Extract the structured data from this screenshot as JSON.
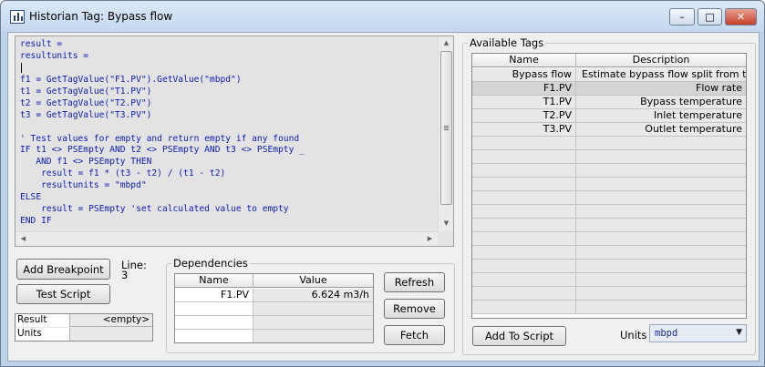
{
  "window": {
    "title": "Historian Tag: Bypass flow",
    "buttons": {
      "minimize": "–",
      "maximize": "□",
      "close": "✕"
    }
  },
  "editor": {
    "lines": [
      "result =",
      "resultunits =",
      "",
      "f1 = GetTagValue(\"F1.PV\").GetValue(\"mbpd\")",
      "t1 = GetTagValue(\"T1.PV\")",
      "t2 = GetTagValue(\"T2.PV\")",
      "t3 = GetTagValue(\"T3.PV\")",
      "",
      "' Test values for empty and return empty if any found",
      "IF t1 <> PSEmpty AND t2 <> PSEmpty AND t3 <> PSEmpty _",
      "   AND f1 <> PSEmpty THEN",
      "    result = f1 * (t3 - t2) / (t1 - t2)",
      "    resultunits = \"mbpd\"",
      "ELSE",
      "    result = PSEmpty 'set calculated value to empty",
      "END IF"
    ]
  },
  "buttons": {
    "add_breakpoint": "Add Breakpoint",
    "test_script": "Test Script",
    "refresh": "Refresh",
    "remove": "Remove",
    "fetch": "Fetch",
    "add_to_script": "Add To Script"
  },
  "line_info": {
    "label": "Line:",
    "value": "3"
  },
  "result_table": [
    {
      "name": "Result",
      "value": "<empty>"
    },
    {
      "name": "Units",
      "value": ""
    }
  ],
  "dependencies": {
    "legend": "Dependencies",
    "columns": [
      "Name",
      "Value"
    ],
    "rows": [
      {
        "name": "F1.PV",
        "value": "6.624 m3/h"
      },
      {
        "name": "",
        "value": ""
      },
      {
        "name": "",
        "value": ""
      },
      {
        "name": "",
        "value": ""
      }
    ]
  },
  "available_tags": {
    "legend": "Available Tags",
    "columns": [
      "Name",
      "Description"
    ],
    "rows": [
      {
        "name": "Bypass flow",
        "description": "Estimate bypass flow split from te"
      },
      {
        "name": "F1.PV",
        "description": "Flow rate"
      },
      {
        "name": "T1.PV",
        "description": "Bypass temperature"
      },
      {
        "name": "T2.PV",
        "description": "Inlet temperature"
      },
      {
        "name": "T3.PV",
        "description": "Outlet temperature"
      },
      {
        "name": "",
        "description": ""
      },
      {
        "name": "",
        "description": ""
      },
      {
        "name": "",
        "description": ""
      },
      {
        "name": "",
        "description": ""
      },
      {
        "name": "",
        "description": ""
      },
      {
        "name": "",
        "description": ""
      },
      {
        "name": "",
        "description": ""
      },
      {
        "name": "",
        "description": ""
      },
      {
        "name": "",
        "description": ""
      },
      {
        "name": "",
        "description": ""
      },
      {
        "name": "",
        "description": ""
      },
      {
        "name": "",
        "description": ""
      },
      {
        "name": "",
        "description": ""
      }
    ]
  },
  "units": {
    "label": "Units",
    "value": "mbpd"
  }
}
